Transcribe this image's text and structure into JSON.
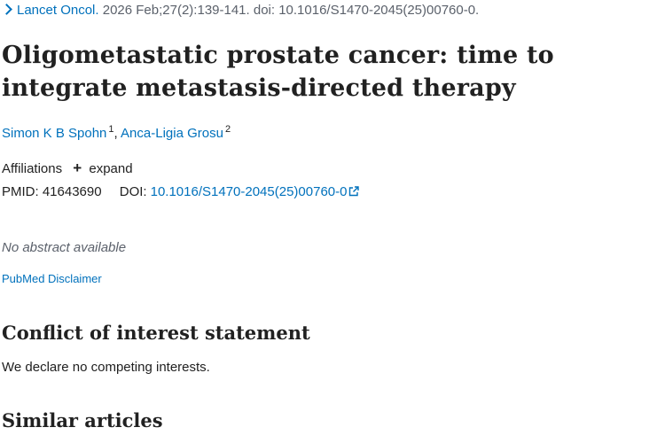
{
  "citation": {
    "journal": "Lancet Oncol.",
    "details": "2026 Feb;27(2):139-141. doi: 10.1016/S1470-2045(25)00760-0."
  },
  "article": {
    "title": "Oligometastatic prostate cancer: time to integrate metastasis-directed therapy"
  },
  "authors": [
    {
      "name": "Simon K B Spohn",
      "affiliation_ref": "1"
    },
    {
      "name": "Anca-Ligia Grosu",
      "affiliation_ref": "2"
    }
  ],
  "author_separator": ",",
  "affiliations": {
    "label": "Affiliations",
    "expand_label": "expand"
  },
  "identifiers": {
    "pmid_label": "PMID:",
    "pmid": "41643690",
    "doi_label": "DOI:",
    "doi": "10.1016/S1470-2045(25)00760-0"
  },
  "abstract": {
    "text": "No abstract available"
  },
  "disclaimer_link": "PubMed Disclaimer",
  "conflict": {
    "heading": "Conflict of interest statement",
    "text": "We declare no competing interests."
  },
  "similar": {
    "heading": "Similar articles"
  },
  "icons": {
    "citation_chevron": "chevron-right-icon",
    "expand": "plus-icon",
    "doi_external": "external-link-icon"
  },
  "colors": {
    "link": "#0071bc",
    "text": "#212121",
    "muted": "#5b616b"
  }
}
